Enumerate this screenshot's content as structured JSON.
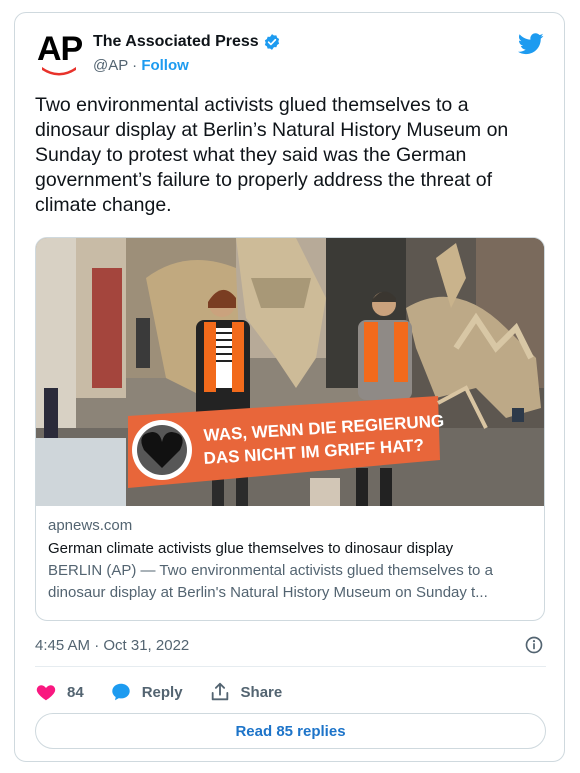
{
  "author": {
    "name": "The Associated Press",
    "handle": "@AP",
    "separator": " · ",
    "follow_label": "Follow",
    "avatar_text": "AP",
    "verified": true
  },
  "tweet": {
    "text": "Two environmental activists glued themselves to a dinosaur display at Berlin’s Natural History Museum on Sunday to protest what they said was the German government’s failure to properly address the threat of climate change."
  },
  "link_card": {
    "image_banner_line1": "WAS, WENN DIE REGIERUNG",
    "image_banner_line2": "DAS NICHT IM GRIFF HAT?",
    "domain": "apnews.com",
    "title": "German climate activists glue themselves to dinosaur display",
    "description": "BERLIN (AP) — Two environmental activists glued themselves to a dinosaur display at Berlin's Natural History Museum on Sunday t..."
  },
  "meta": {
    "timestamp": "4:45 AM · Oct 31, 2022"
  },
  "actions": {
    "like_count": "84",
    "reply_label": "Reply",
    "share_label": "Share"
  },
  "read_replies_label": "Read 85 replies",
  "colors": {
    "accent": "#1d9bf0",
    "like": "#f91880",
    "text": "#0f1419",
    "muted": "#536471",
    "border": "#cfd9de",
    "banner": "#e8663a"
  }
}
